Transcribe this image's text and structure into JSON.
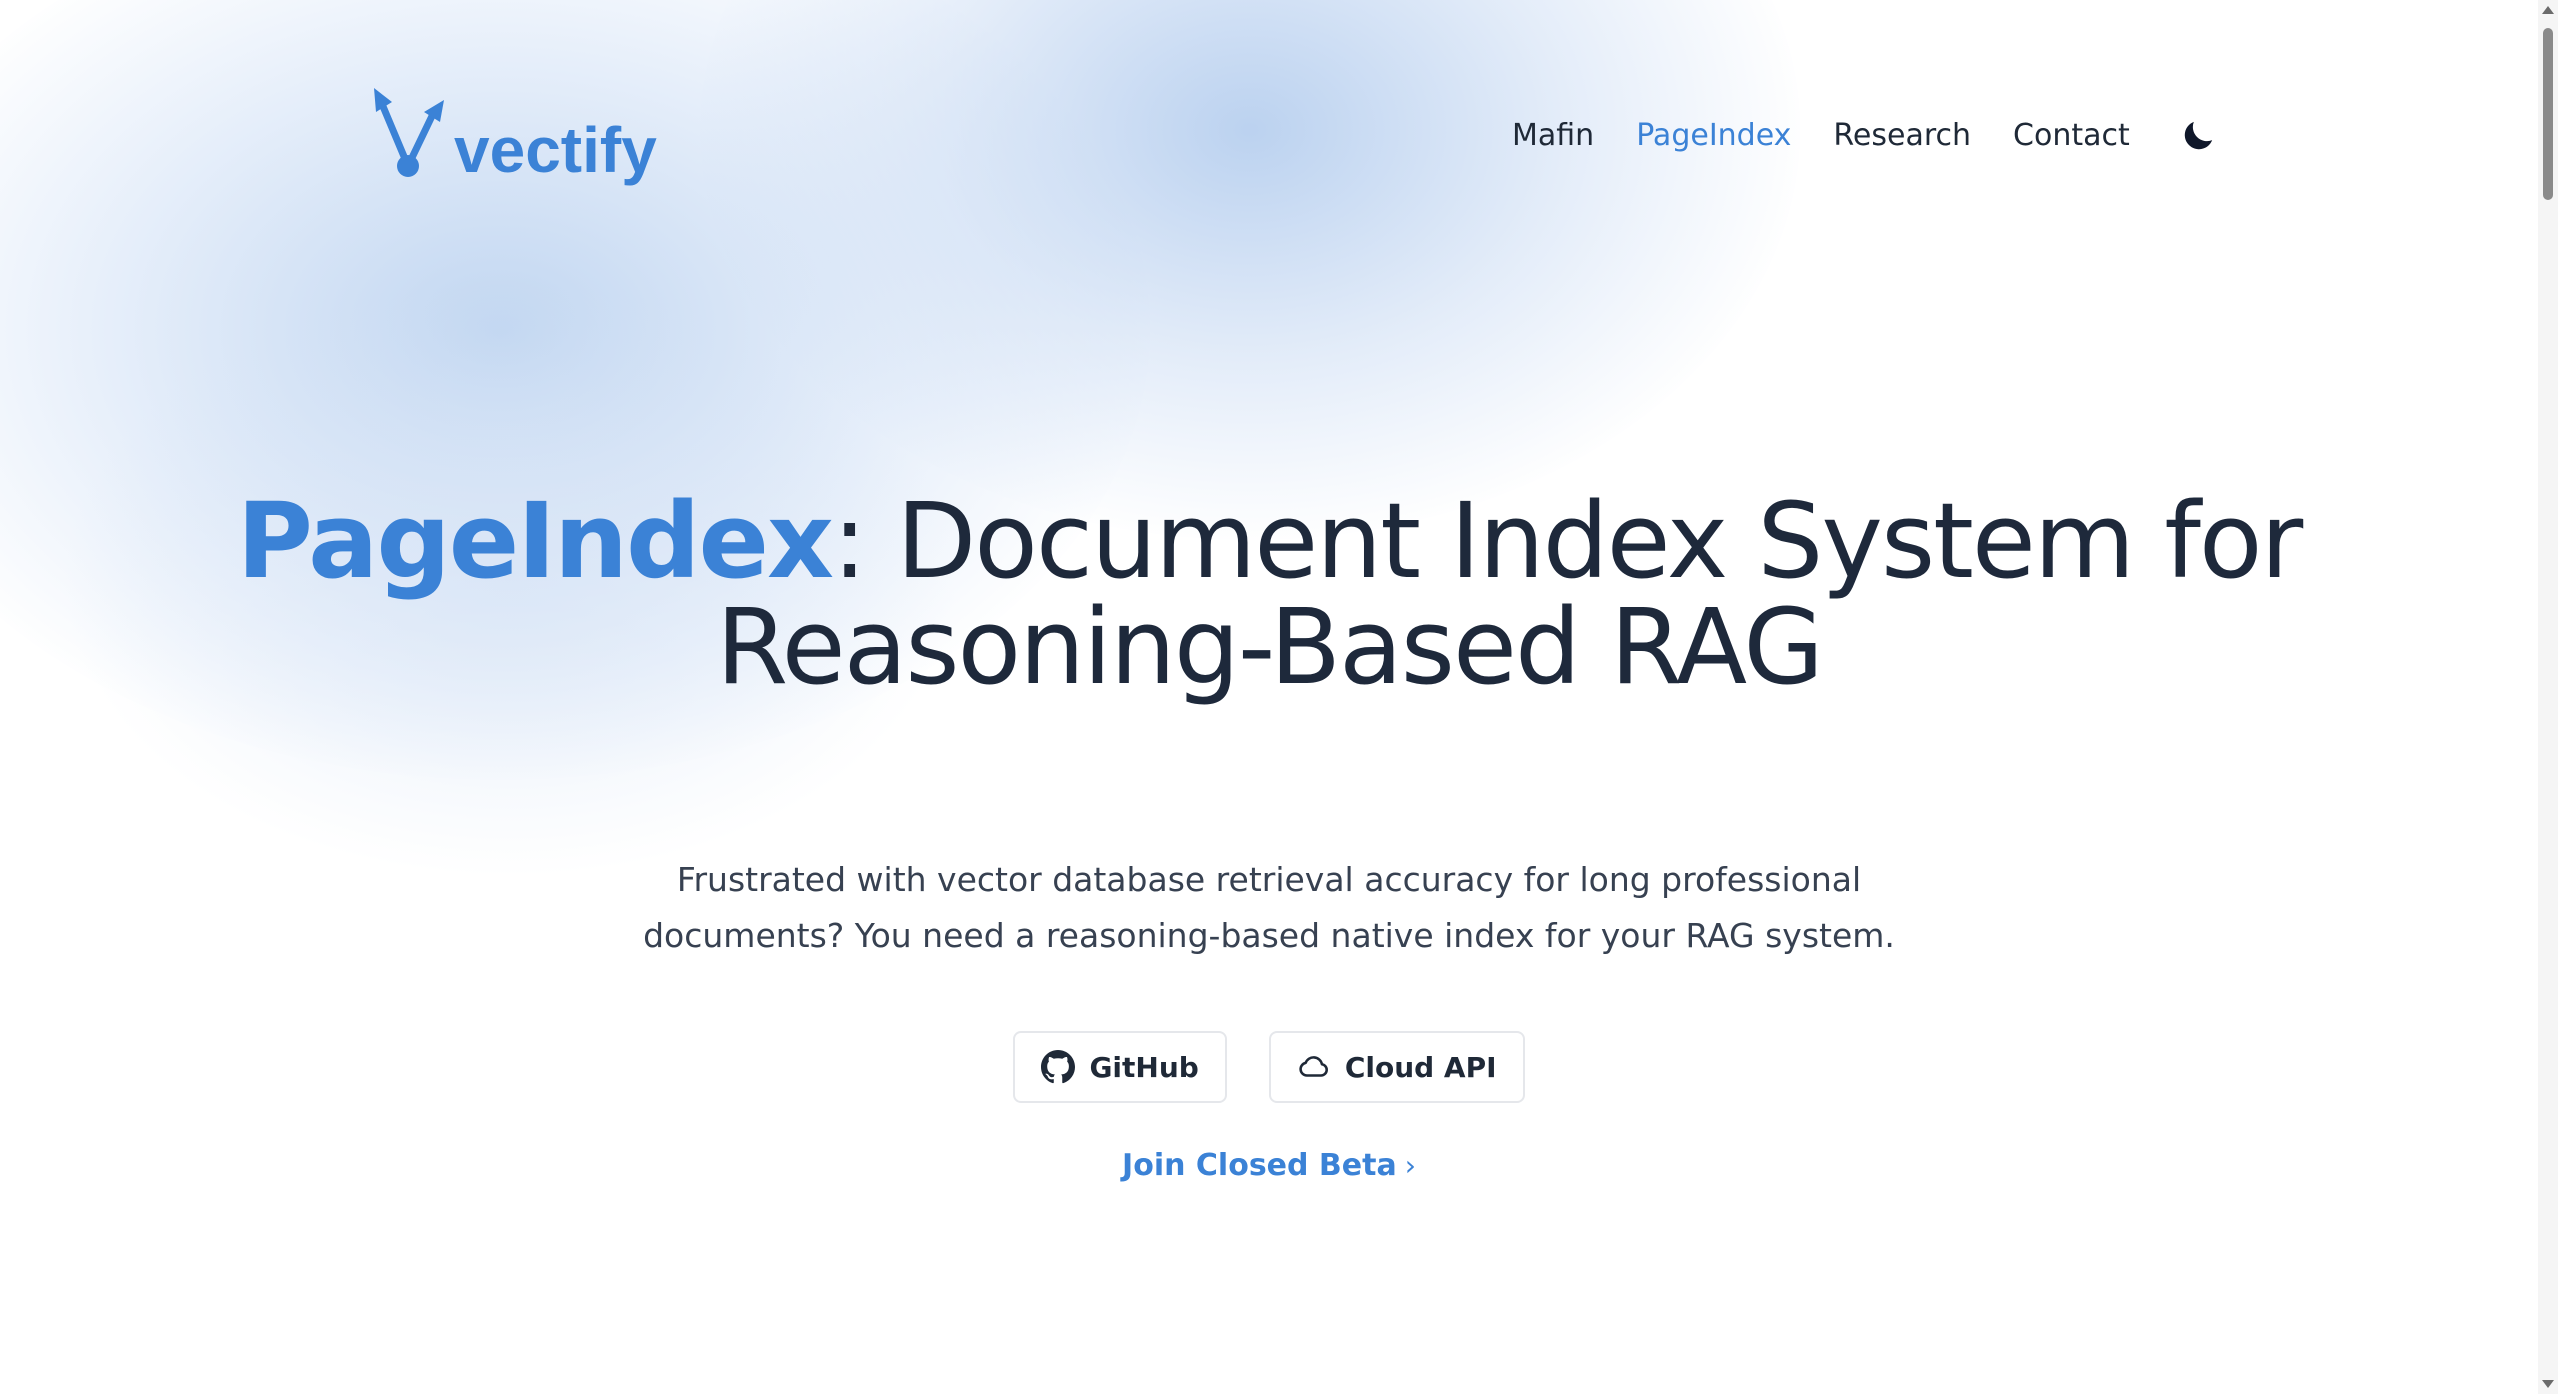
{
  "header": {
    "logo_text": "vectify",
    "nav": [
      {
        "label": "Mafin",
        "active": false
      },
      {
        "label": "PageIndex",
        "active": true
      },
      {
        "label": "Research",
        "active": false
      },
      {
        "label": "Contact",
        "active": false
      }
    ],
    "theme_toggle_icon": "moon-icon"
  },
  "hero": {
    "title_brand": "PageIndex",
    "title_rest": ": Document Index System for Reasoning-Based RAG",
    "subtitle_line1": "Frustrated with vector database retrieval accuracy for long professional",
    "subtitle_line2": "documents? You need a reasoning-based native index for your RAG system.",
    "buttons": [
      {
        "label": "GitHub",
        "icon": "github-icon"
      },
      {
        "label": "Cloud API",
        "icon": "cloud-icon"
      }
    ],
    "beta_link": "Join Closed Beta",
    "beta_chevron": "›"
  },
  "colors": {
    "accent": "#3b82d6",
    "text": "#1e293b",
    "muted_text": "#374151"
  }
}
